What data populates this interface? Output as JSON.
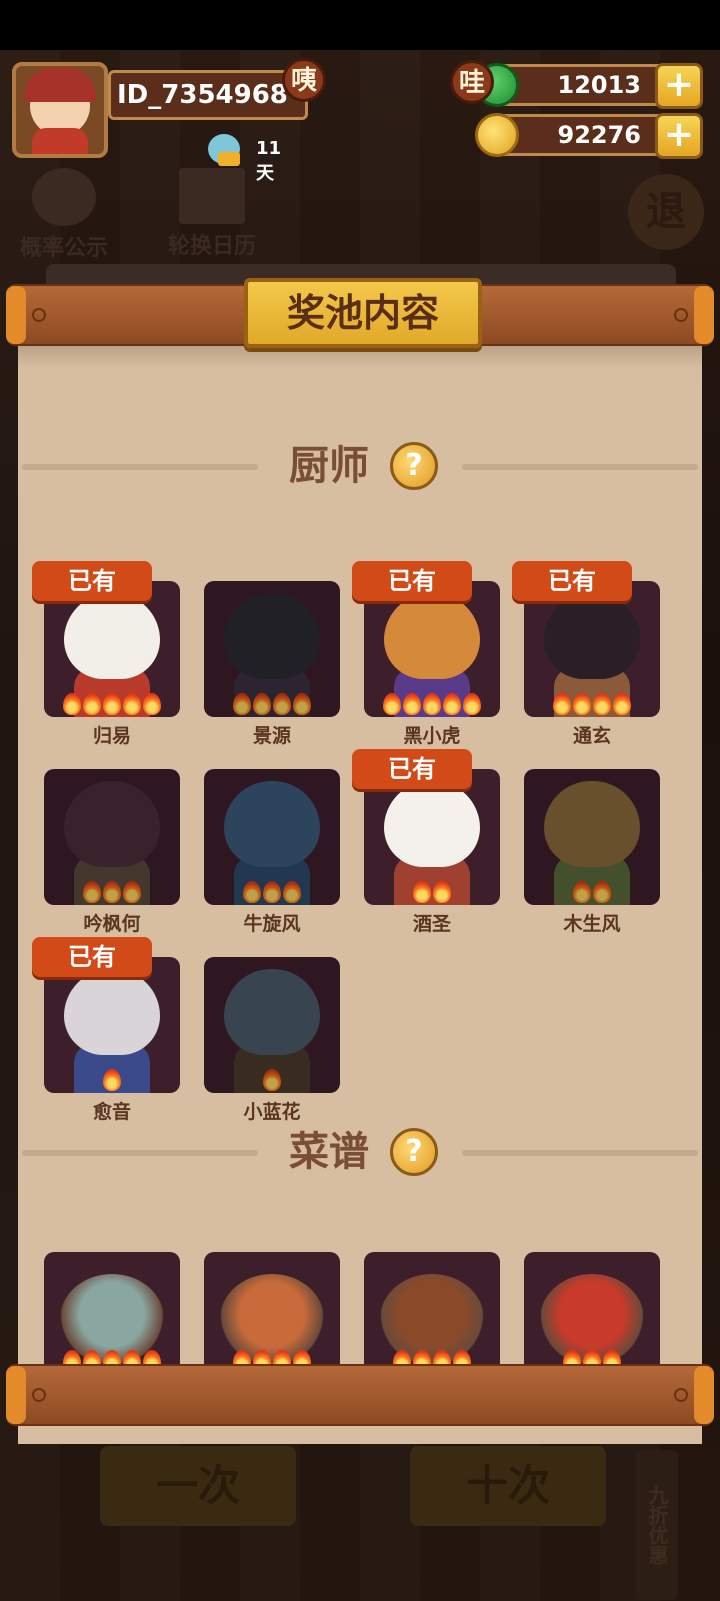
{
  "player": {
    "id": "ID_7354968",
    "badge": "咦",
    "days": "11天"
  },
  "currencies": [
    {
      "name": "jade",
      "badge": "哇",
      "value": "12013",
      "plus": "+"
    },
    {
      "name": "gold",
      "value": "92276",
      "plus": "+"
    }
  ],
  "background_menu": {
    "probability": "概率公示",
    "calendar": "轮换日历",
    "exit": "退",
    "draw_once": "一次",
    "draw_ten": "十次",
    "discount": "九折优惠"
  },
  "dialog": {
    "title": "奖池内容",
    "owned_label": "已有",
    "chef_section": {
      "label": "厨师",
      "help": "?",
      "items": [
        {
          "name": "归易",
          "owned": true,
          "stars": 5,
          "color": "#f2efe9",
          "body": "#b73a2a"
        },
        {
          "name": "景源",
          "owned": false,
          "stars": 4,
          "color": "#2a2a32",
          "body": "#3a3040"
        },
        {
          "name": "黑小虎",
          "owned": true,
          "stars": 5,
          "color": "#d48a3a",
          "body": "#5a3a8a"
        },
        {
          "name": "通玄",
          "owned": true,
          "stars": 4,
          "color": "#2b1e26",
          "body": "#8a5a3a"
        },
        {
          "name": "吟枫何",
          "owned": false,
          "stars": 3,
          "color": "#4a2e3a",
          "body": "#5a4a3a"
        },
        {
          "name": "牛旋风",
          "owned": false,
          "stars": 3,
          "color": "#3a5a7a",
          "body": "#2a4a6a"
        },
        {
          "name": "酒圣",
          "owned": true,
          "stars": 2,
          "color": "#f4f1ec",
          "body": "#a04030"
        },
        {
          "name": "木生风",
          "owned": false,
          "stars": 2,
          "color": "#8a6a3a",
          "body": "#5a6a3a"
        },
        {
          "name": "愈音",
          "owned": true,
          "stars": 1,
          "color": "#d8d4d8",
          "body": "#3a4a8a"
        },
        {
          "name": "小蓝花",
          "owned": false,
          "stars": 1,
          "color": "#4a5a6a",
          "body": "#4a3a2a"
        }
      ]
    },
    "recipe_section": {
      "label": "菜谱",
      "help": "?",
      "items": [
        {
          "stars": 5,
          "color": "#8aa6a0"
        },
        {
          "stars": 4,
          "color": "#c86a3a"
        },
        {
          "stars": 4,
          "color": "#8a4a2a"
        },
        {
          "stars": 3,
          "color": "#c83a2a"
        }
      ]
    }
  },
  "colors": {
    "accent_orange": "#d24a18",
    "paper": "#d8bea0",
    "tile": "#3d1f2c"
  }
}
